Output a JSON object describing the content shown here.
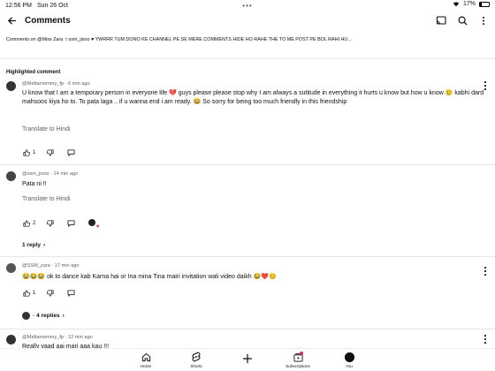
{
  "status_bar": {
    "time": "12:56 PM",
    "date": "Sun 26 Oct",
    "battery": "17%",
    "battery_level": 0.17
  },
  "header": {
    "title": "Comments"
  },
  "pinned_comment": {
    "text": "Comments on @Miss Zara ☆ssm_jisoo ♥ YWRRR TUM DONO KE CHANNEL PE SE MERE COMMENTS HIDE HO RAHE THE TO ME POST PE BOL RAHI HU..."
  },
  "section_label": "Highlighted comment",
  "comments": [
    {
      "author": "@Mafiamommy_fp",
      "time": "6 min ago",
      "text": "U know that I am a temporary person in everyone life 💔 guys please please stop why I am always a sutitude in everything it hurts u know but how u know 🥲 kabhi dard mahsoos kiya ho to. To pata laga .. if u wanna end i am ready. 😂 So sorry for being too much friendly in this friendship",
      "translate": "Translate to Hindi",
      "likes": "1"
    },
    {
      "author": "@ssm_jisoo",
      "time": "14 min ago",
      "text": "Pata ni !!",
      "translate": "Translate to Hindi",
      "likes": "2",
      "replies": "1 reply"
    },
    {
      "author": "@SSM_zara",
      "time": "17 min ago",
      "text": "😂😂😂 ok to dance kab Karna hai or Ina mina Tina mairi invitation wali video daikh 😂❤️😊",
      "likes": "1",
      "replies": "4 replies"
    },
    {
      "author": "@Mafiamommy_fp",
      "time": "12 min ago",
      "text": "Really yaad aai mari aaa kau !!!"
    }
  ],
  "bottom_nav": {
    "items": [
      {
        "label": "Home",
        "icon": "home-icon"
      },
      {
        "label": "Shorts",
        "icon": "shorts-icon"
      },
      {
        "label": "",
        "icon": "create-icon"
      },
      {
        "label": "Subscriptions",
        "icon": "subscriptions-icon"
      },
      {
        "label": "You",
        "icon": "you-avatar"
      }
    ]
  },
  "colors": {
    "text_primary": "#0f0f0f",
    "text_secondary": "#606060",
    "heart": "#e3264b",
    "divider": "#e5e5e5"
  }
}
